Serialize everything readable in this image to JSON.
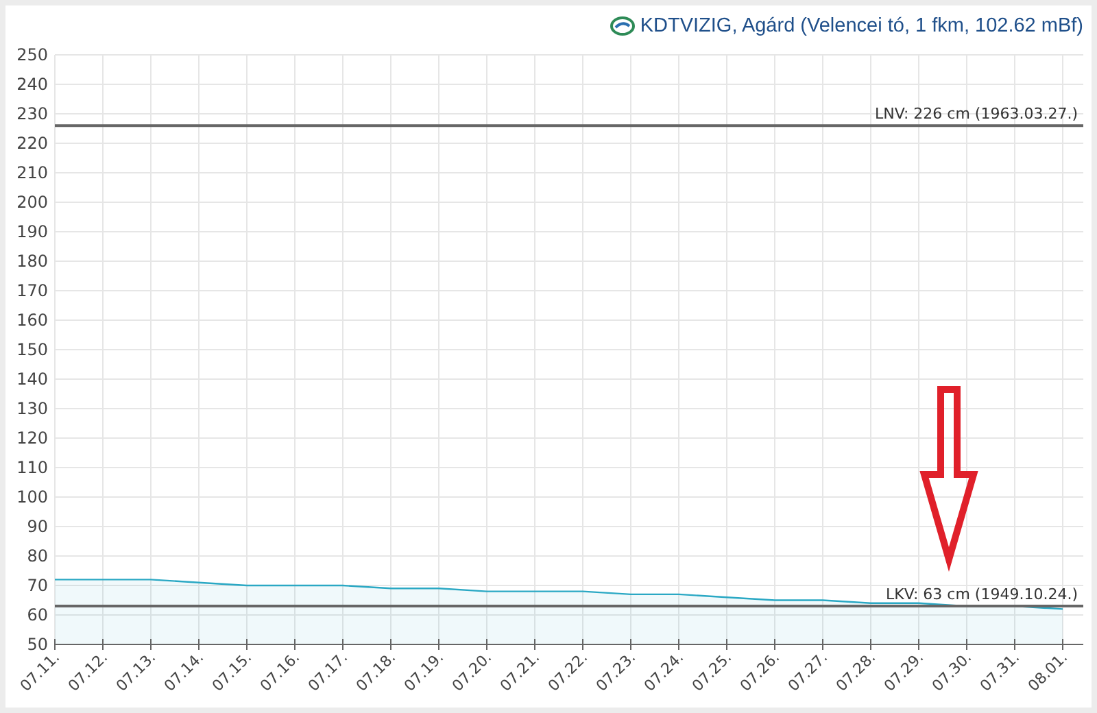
{
  "header": {
    "title": "KDTVIZIG, Agárd (Velencei tó, 1 fkm, 102.62 mBf)"
  },
  "chart": {
    "chart_data": {
      "type": "area",
      "grid": true,
      "x": [
        "07.11.",
        "07.12.",
        "07.13.",
        "07.14.",
        "07.15.",
        "07.16.",
        "07.17.",
        "07.18.",
        "07.19.",
        "07.20.",
        "07.21.",
        "07.22.",
        "07.23.",
        "07.24.",
        "07.25.",
        "07.26.",
        "07.27.",
        "07.28.",
        "07.29.",
        "07.30.",
        "07.31.",
        "08.01."
      ],
      "series": [
        {
          "color": "#2aa8c4",
          "values": [
            72,
            72,
            72,
            71,
            70,
            70,
            70,
            69,
            69,
            68,
            68,
            68,
            67,
            67,
            66,
            65,
            65,
            64,
            64,
            63,
            63,
            62
          ]
        }
      ],
      "ylim": [
        50,
        250
      ],
      "yticks": [
        50,
        60,
        70,
        80,
        90,
        100,
        110,
        120,
        130,
        140,
        150,
        160,
        170,
        180,
        190,
        200,
        210,
        220,
        230,
        240,
        250
      ],
      "ref_lines": [
        {
          "axis": "y",
          "value": 226,
          "label": "LNV: 226 cm (1963.03.27.)"
        },
        {
          "axis": "y",
          "value": 63,
          "label": "LKV: 63 cm (1949.10.24.)"
        }
      ]
    }
  }
}
